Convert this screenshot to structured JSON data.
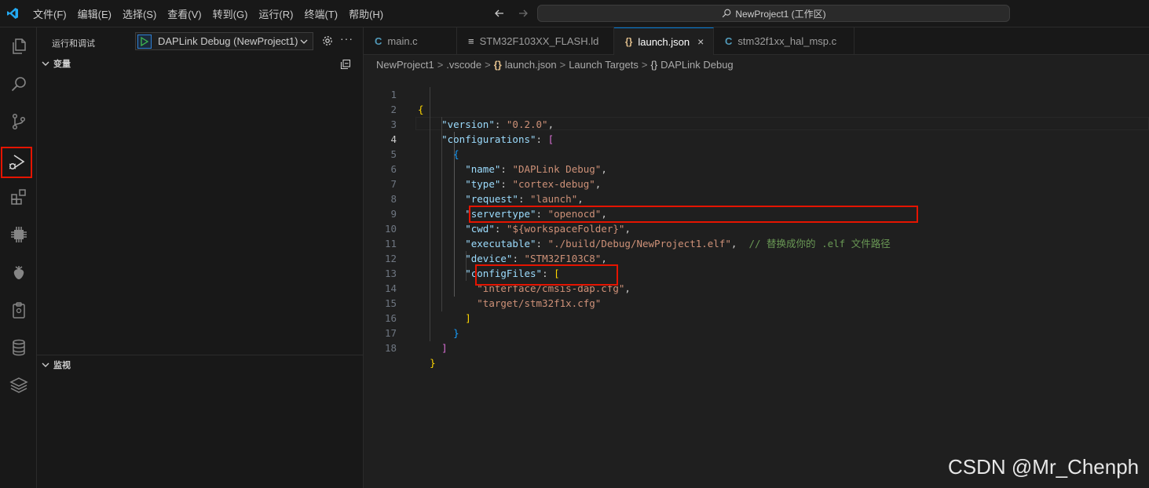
{
  "titlebar": {
    "menu": [
      "文件(F)",
      "编辑(E)",
      "选择(S)",
      "查看(V)",
      "转到(G)",
      "运行(R)",
      "终端(T)",
      "帮助(H)"
    ],
    "search_text": "NewProject1 (工作区)"
  },
  "activity_bar": {
    "items": [
      "explorer-icon",
      "search-icon",
      "source-control-icon",
      "run-debug-icon",
      "extensions-icon",
      "chip-icon",
      "strawberry-icon",
      "clipboard-icon",
      "database-icon",
      "layers-icon"
    ],
    "active": "run-debug-icon"
  },
  "sidebar": {
    "title": "运行和调试",
    "launch_config": "DAPLink Debug (NewProject1)",
    "sections": {
      "variables": "变量",
      "watch": "监视"
    }
  },
  "tabs": [
    {
      "icon": "C",
      "label": "main.c",
      "active": false
    },
    {
      "icon": "≡",
      "label": "STM32F103XX_FLASH.ld",
      "active": false
    },
    {
      "icon": "{}",
      "label": "launch.json",
      "active": true,
      "close": "×"
    },
    {
      "icon": "C",
      "label": "stm32f1xx_hal_msp.c",
      "active": false
    }
  ],
  "breadcrumb": {
    "items": [
      "NewProject1",
      ".vscode",
      "launch.json",
      "Launch Targets",
      "DAPLink Debug"
    ],
    "icon": "{}",
    "separator": ">"
  },
  "editor": {
    "current_line": 4,
    "line_numbers": [
      "1",
      "2",
      "3",
      "4",
      "5",
      "6",
      "7",
      "8",
      "9",
      "10",
      "11",
      "12",
      "13",
      "14",
      "15",
      "16",
      "17",
      "18"
    ],
    "code": {
      "version_key": "\"version\"",
      "version_val": "\"0.2.0\"",
      "configurations_key": "\"configurations\"",
      "name_key": "\"name\"",
      "name_val": "\"DAPLink Debug\"",
      "type_key": "\"type\"",
      "type_val": "\"cortex-debug\"",
      "request_key": "\"request\"",
      "request_val": "\"launch\"",
      "servertype_key": "\"servertype\"",
      "servertype_val": "\"openocd\"",
      "cwd_key": "\"cwd\"",
      "cwd_val": "\"${workspaceFolder}\"",
      "executable_key": "\"executable\"",
      "executable_val": "\"./build/Debug/NewProject1.elf\"",
      "executable_comment": "// 替换成你的 .elf 文件路径",
      "device_key": "\"device\"",
      "device_val": "\"STM32F103C8\"",
      "configfiles_key": "\"configFiles\"",
      "cfg1": "\"interface/cmsis-dap.cfg\"",
      "cfg2": "\"target/stm32f1x.cfg\""
    }
  },
  "watermark": "CSDN @Mr_Chenph",
  "colors": {
    "highlight_box": "#e51400",
    "accent": "#0078d4"
  }
}
